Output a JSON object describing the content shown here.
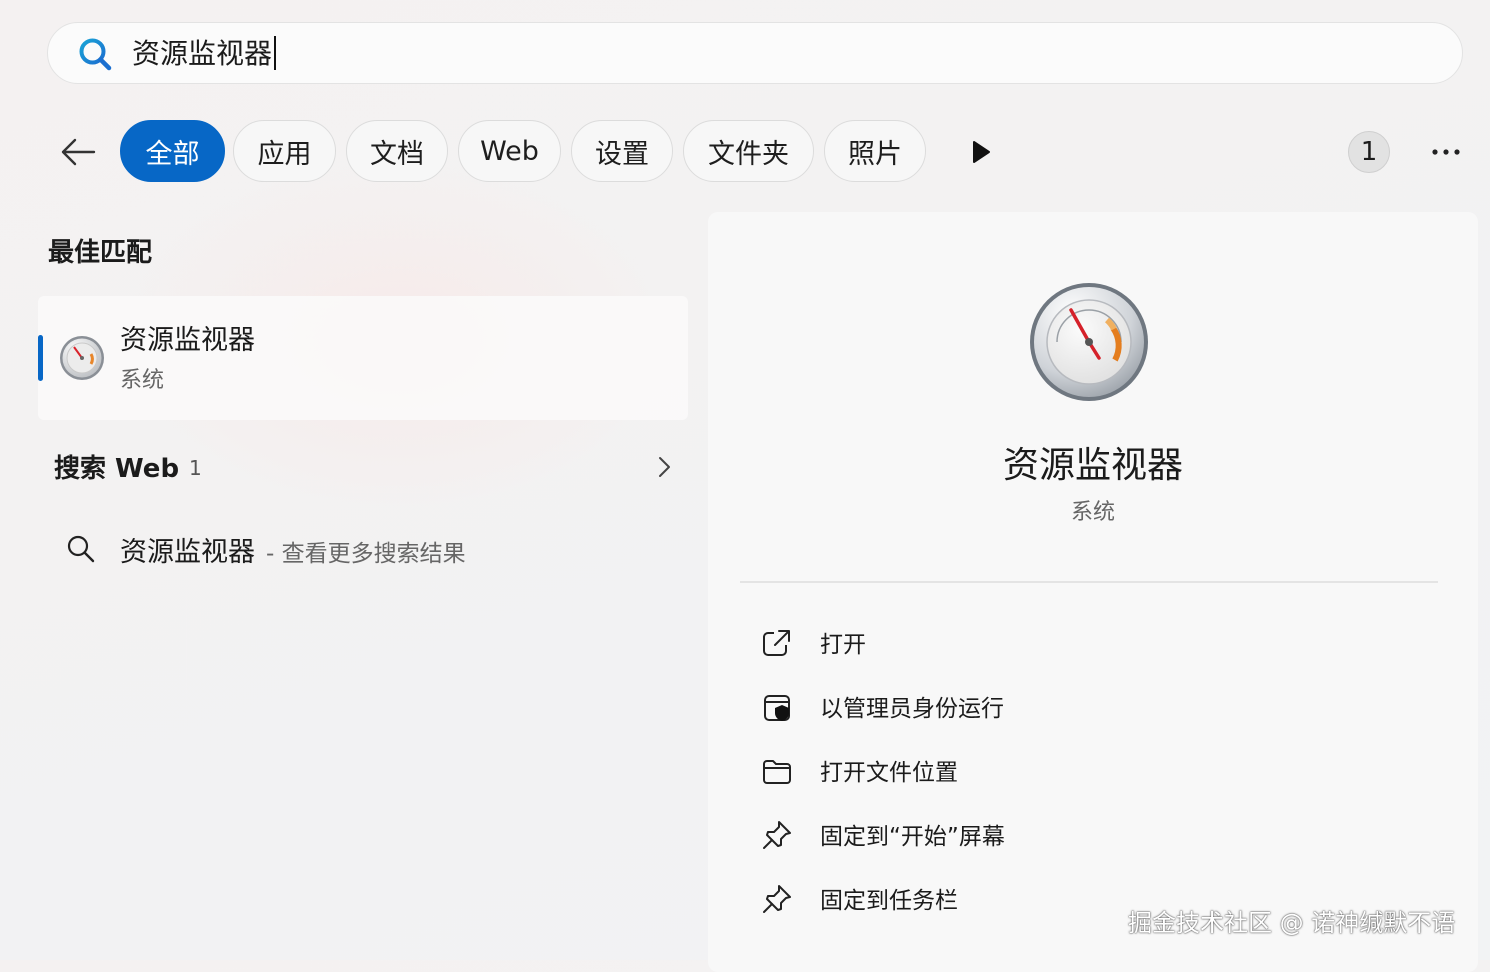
{
  "search": {
    "value": "资源监视器"
  },
  "filters": [
    {
      "label": "全部",
      "active": true
    },
    {
      "label": "应用"
    },
    {
      "label": "文档"
    },
    {
      "label": "Web"
    },
    {
      "label": "设置"
    },
    {
      "label": "文件夹"
    },
    {
      "label": "照片"
    }
  ],
  "header": {
    "result_count": "1"
  },
  "best_match": {
    "section_title": "最佳匹配",
    "name": "资源监视器",
    "type": "系统"
  },
  "web": {
    "section_title": "搜索 Web",
    "count": "1",
    "term": "资源监视器",
    "hint": "- 查看更多搜索结果"
  },
  "details": {
    "name": "资源监视器",
    "type": "系统",
    "actions": [
      {
        "label": "打开",
        "icon": "open-external-icon"
      },
      {
        "label": "以管理员身份运行",
        "icon": "shield-admin-icon"
      },
      {
        "label": "打开文件位置",
        "icon": "folder-icon"
      },
      {
        "label": "固定到“开始”屏幕",
        "icon": "pin-icon"
      },
      {
        "label": "固定到任务栏",
        "icon": "pin-icon"
      }
    ]
  },
  "watermark": "掘金技术社区 @ 诺神缄默不语",
  "colors": {
    "accent": "#0767c6",
    "background": "#f3f2f2",
    "panel": "#f8f8f8"
  }
}
